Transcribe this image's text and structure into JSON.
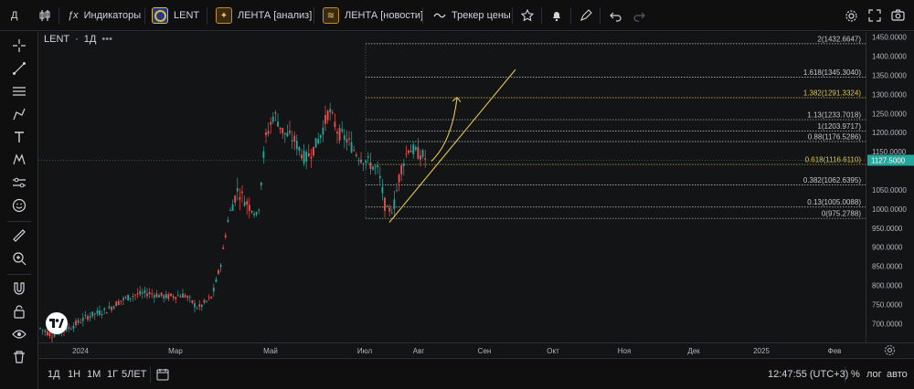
{
  "toolbar": {
    "symbol_search_label": "Д",
    "indicators_label": "Индикаторы",
    "symbol": "LENT",
    "analysis_label": "ЛЕНТА [анализ]",
    "news_label": "ЛЕНТА [новости]",
    "tracker_label": "Трекер цены"
  },
  "legend": {
    "symbol": "LENT",
    "interval": "1Д",
    "more": "•••"
  },
  "price_axis": {
    "ticks": [
      "1450.0000",
      "1400.0000",
      "1350.0000",
      "1300.0000",
      "1250.0000",
      "1200.0000",
      "1150.0000",
      "1050.0000",
      "1000.0000",
      "950.0000",
      "900.0000",
      "850.0000",
      "800.0000",
      "750.0000",
      "700.0000"
    ],
    "current_price": "1127.5000",
    "current_price_color": "#26a69a"
  },
  "time_axis": {
    "ticks": [
      "2024",
      "Мар",
      "Май",
      "Июл",
      "Авг",
      "Сен",
      "Окт",
      "Ноя",
      "Дек",
      "2025",
      "Фев"
    ]
  },
  "fib_levels": [
    {
      "label": "2(1432.6647)",
      "color": "#c8c8c8"
    },
    {
      "label": "1.618(1345.3040)",
      "color": "#c8c8c8"
    },
    {
      "label": "1.382(1291.3324)",
      "color": "#e2c44a"
    },
    {
      "label": "1.13(1233.7018)",
      "color": "#c8c8c8"
    },
    {
      "label": "1(1203.9717)",
      "color": "#c8c8c8"
    },
    {
      "label": "0.88(1176.5286)",
      "color": "#c8c8c8"
    },
    {
      "label": "0.618(1116.6110)",
      "color": "#e2c44a"
    },
    {
      "label": "0.382(1062.6395)",
      "color": "#c8c8c8"
    },
    {
      "label": "0.13(1005.0088)",
      "color": "#c8c8c8"
    },
    {
      "label": "0(975.2788)",
      "color": "#c8c8c8"
    }
  ],
  "bottom": {
    "ranges": [
      "1Д",
      "1Н",
      "1М",
      "1Г",
      "5ЛЕТ"
    ],
    "time": "12:47:55 (UTC+3)",
    "percent": "%",
    "log": "лог",
    "auto": "авто"
  },
  "colors": {
    "up": "#26a69a",
    "down": "#ef5350",
    "accent": "#e2c44a"
  },
  "chart_data": {
    "type": "candlestick",
    "price_unit": "RUB",
    "period": "daily",
    "approx_path": [
      {
        "x": "Янв 2024",
        "y": 680
      },
      {
        "x": "Фев",
        "y": 740
      },
      {
        "x": "Мар",
        "y": 770
      },
      {
        "x": "Апр",
        "y": 1000
      },
      {
        "x": "Май",
        "y": 1250
      },
      {
        "x": "Июн",
        "y": 1200
      },
      {
        "x": "Июл",
        "y": 1100
      },
      {
        "x": "Авг",
        "y": 1130
      }
    ],
    "last_price": 1127.5,
    "ylim": [
      680,
      1460
    ]
  }
}
